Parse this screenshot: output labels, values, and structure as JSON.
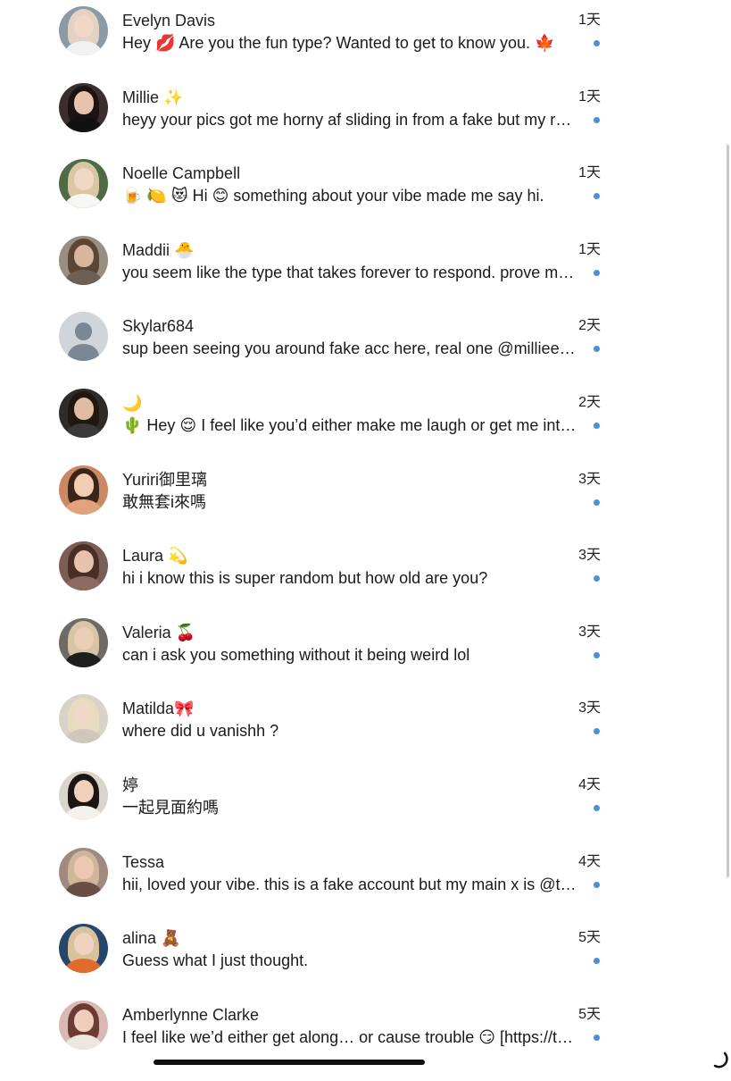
{
  "conversations": [
    {
      "name": "Evelyn Davis",
      "message": "Hey 💋 Are you the fun type? Wanted to get to know you. 🍁",
      "time": "1天",
      "avatar": {
        "kind": "photo",
        "icon": "avatar-photo",
        "bg": "#8a9aa6",
        "hair": "#e3d2c3",
        "skin": "#f0d7c8",
        "top": "#f2f2f2"
      }
    },
    {
      "name": "Millie ✨",
      "message": "heyy your pics got me horny af sliding in from a fake but my real one is…",
      "time": "1天",
      "avatar": {
        "kind": "photo",
        "icon": "avatar-photo",
        "bg": "#3a2e2e",
        "hair": "#1c1414",
        "skin": "#e7c3ad",
        "top": "#111111"
      }
    },
    {
      "name": "Noelle Campbell",
      "message": "🍺 🍋 😻 Hi 😊 something about your vibe made me say hi.",
      "time": "1天",
      "avatar": {
        "kind": "photo",
        "icon": "avatar-photo",
        "bg": "#4e6b45",
        "hair": "#d9c7a4",
        "skin": "#efd9c4",
        "top": "#f6f6f4"
      }
    },
    {
      "name": "Maddii 🐣",
      "message": "you seem like the type that takes forever to respond. prove me…",
      "time": "1天",
      "avatar": {
        "kind": "photo",
        "icon": "avatar-photo",
        "bg": "#9a8e82",
        "hair": "#5b4636",
        "skin": "#d9b79f",
        "top": "#6e5f55"
      }
    },
    {
      "name": "Skylar684",
      "message": "sup been seeing you around fake acc here, real one @millieem…",
      "time": "2天",
      "avatar": {
        "kind": "default",
        "icon": "default-avatar-icon"
      }
    },
    {
      "name": "🌙",
      "message": "🌵 Hey 😌 I feel like you’d either make me laugh or get me into…",
      "time": "2天",
      "avatar": {
        "kind": "photo",
        "icon": "avatar-photo",
        "bg": "#2f2b29",
        "hair": "#20180f",
        "skin": "#e1bca4",
        "top": "#3a3a3a"
      }
    },
    {
      "name": "Yuriri御里璃",
      "message": "敢無套i來嗎",
      "time": "3天",
      "avatar": {
        "kind": "photo",
        "icon": "avatar-photo",
        "bg": "#c98a63",
        "hair": "#3a2418",
        "skin": "#f1cdb3",
        "top": "#e2a37c"
      }
    },
    {
      "name": "Laura 💫",
      "message": "hi i know this is super random but how old are you?",
      "time": "3天",
      "avatar": {
        "kind": "photo",
        "icon": "avatar-photo",
        "bg": "#7a5d55",
        "hair": "#4a2f26",
        "skin": "#e9c2ad",
        "top": "#8e6a60"
      }
    },
    {
      "name": "Valeria 🍒",
      "message": "can i ask you something without it being weird lol",
      "time": "3天",
      "avatar": {
        "kind": "photo",
        "icon": "avatar-photo",
        "bg": "#6f6a64",
        "hair": "#d8c4a6",
        "skin": "#eccdb8",
        "top": "#1e1e1e"
      }
    },
    {
      "name": "Matilda🎀",
      "message": "where did u vanishh ?",
      "time": "3天",
      "avatar": {
        "kind": "photo",
        "icon": "avatar-photo",
        "bg": "#d8d2c8",
        "hair": "#e8dcc0",
        "skin": "#f1d8c6",
        "top": "#cfc7bb"
      }
    },
    {
      "name": "婷",
      "message": "一起見面約嗎",
      "time": "4天",
      "avatar": {
        "kind": "photo",
        "icon": "avatar-photo",
        "bg": "#d9d4cc",
        "hair": "#1b1613",
        "skin": "#efd0bb",
        "top": "#f4f1ec"
      }
    },
    {
      "name": "Tessa",
      "message": "hii, loved your vibe. this is a fake account but my main x is @tes…",
      "time": "4天",
      "avatar": {
        "kind": "photo",
        "icon": "avatar-photo",
        "bg": "#a08a80",
        "hair": "#cfb59a",
        "skin": "#ecc8b3",
        "top": "#6a4e45"
      }
    },
    {
      "name": "alina 🧸",
      "message": "Guess what I just thought.",
      "time": "5天",
      "avatar": {
        "kind": "photo",
        "icon": "avatar-photo",
        "bg": "#27466b",
        "hair": "#d7c29c",
        "skin": "#efd3bf",
        "top": "#e06b2a"
      }
    },
    {
      "name": "Amberlynne Clarke",
      "message": "I feel like we’d either get along… or cause trouble 😏 [https://t.co/…",
      "time": "5天",
      "avatar": {
        "kind": "photo",
        "icon": "avatar-photo",
        "bg": "#d8b9b4",
        "hair": "#6d3b33",
        "skin": "#f0cdbd",
        "top": "#efe5df"
      }
    }
  ],
  "unread_indicator": {
    "icon": "unread-dot",
    "color": "#4a90d9"
  }
}
